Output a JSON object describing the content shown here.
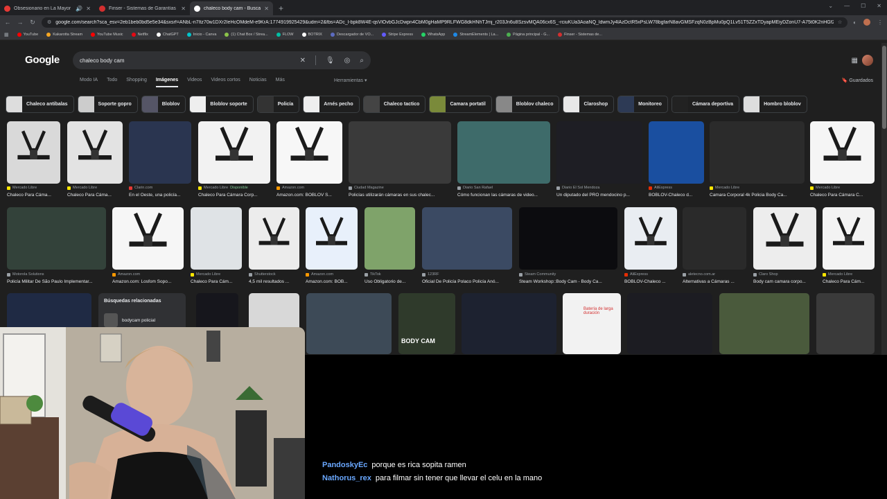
{
  "browser": {
    "tabs": [
      {
        "title": "Obsesionario en La Mayor",
        "color": "#e53935"
      },
      {
        "title": "Finser - Sistemas de Garantías",
        "color": "#d32f2f"
      },
      {
        "title": "chaleco body cam - Buscar con Google",
        "color": "#ffffff"
      }
    ],
    "new_tab": "+",
    "url": "google.com/search?sca_esv=2eb1beb0bd5e5e34&sxsrf=ANbL-n7Itz70w1DXr2IeHcOMdeM-e9KrA:1774919925429&udm=2&fbs=ADc_l-bpk8W4E-qsVlOvbGJcDwpn4CbM0gHaMP9RLFWG8dkHNhTJmj_r203Jn6u8SzsvMQA06cx6S_-rciuKUa3AoaNQ_ldwmJy4lAzDctR5xPsLW78bgfarN8avGMSFzqN0zBpMu0pQ1Lv51T5ZZxTDyapMEiyDZonU7-A75t0K2nHGf2sdoDr..."
  },
  "bookmarks": [
    {
      "label": "YouTube",
      "color": "#ff0000"
    },
    {
      "label": "Kakarotta Stream",
      "color": "#f5a623"
    },
    {
      "label": "YouTube Music",
      "color": "#ff0000"
    },
    {
      "label": "Netflix",
      "color": "#e50914"
    },
    {
      "label": "ChatGPT",
      "color": "#ffffff"
    },
    {
      "label": "Inicio - Canva",
      "color": "#00c4cc"
    },
    {
      "label": "(1) Chat Box / Strea...",
      "color": "#8bc34a"
    },
    {
      "label": "FLOW",
      "color": "#00bfa5"
    },
    {
      "label": "BOTRIX",
      "color": "#ffffff"
    },
    {
      "label": "Descargador de VO...",
      "color": "#5c6bc0"
    },
    {
      "label": "Stripe Express",
      "color": "#635bff"
    },
    {
      "label": "WhatsApp",
      "color": "#25d366"
    },
    {
      "label": "StreamElements | La...",
      "color": "#1e88e5"
    },
    {
      "label": "Página principal - G...",
      "color": "#4caf50"
    },
    {
      "label": "Finser - Sistemas de...",
      "color": "#d32f2f"
    }
  ],
  "google": {
    "logo": "Google",
    "query": "chaleco body cam",
    "tabs": [
      "Modo IA",
      "Todo",
      "Shopping",
      "Imágenes",
      "Videos",
      "Videos cortos",
      "Noticias",
      "Más"
    ],
    "active_tab": "Imágenes",
    "tools": "Herramientas",
    "saved": "Guardados"
  },
  "chips": [
    "Chaleco antibalas",
    "Soporte gopro",
    "Bloblov",
    "Bloblov soporte",
    "Policía",
    "Arnés pecho",
    "Chaleco tactico",
    "Camara portatil",
    "Bloblov chaleco",
    "Claroshop",
    "Monitoreo",
    "Cámara deportiva",
    "Hombro bloblov"
  ],
  "row1": [
    {
      "source": "Mercado Libre",
      "title": "Chaleco Para Cáma...",
      "avail": "",
      "bg": "#d9d9d9"
    },
    {
      "source": "Mercado Libre",
      "title": "Chaleco Para Cáma...",
      "avail": "",
      "bg": "#e3e3e3"
    },
    {
      "source": "Clarin.com",
      "title": "En el Oeste, una policía...",
      "avail": "",
      "bg": "#2a3550"
    },
    {
      "source": "Mercado Libre",
      "title": "Chaleco Para Cámara Corp...",
      "avail": "Disponible",
      "bg": "#f2f2f2"
    },
    {
      "source": "Amazon.com",
      "title": "Amazon.com: BOBLOV S...",
      "avail": "",
      "bg": "#f7f7f7"
    },
    {
      "source": "Ciudad Magazine",
      "title": "Policías utilizarán cámaras en sus chalec...",
      "avail": "",
      "bg": "#3a3a3a"
    },
    {
      "source": "Diario San Rafael",
      "title": "Cómo funcionan las cámaras de video...",
      "avail": "",
      "bg": "#3e6b6a"
    },
    {
      "source": "Diario El Sol Mendoza",
      "title": "Un diputado del PRO mendocino p...",
      "avail": "",
      "bg": "#1e1e24"
    },
    {
      "source": "AliExpress",
      "title": "BOBLOV-Chaleco d...",
      "avail": "",
      "bg": "#1a4fa0"
    },
    {
      "source": "Mercado Libre",
      "title": "Camara Corporal 4k Policia Body Ca...",
      "avail": "",
      "bg": "#2b2b2b"
    },
    {
      "source": "Mercado Libre",
      "title": "Chaleco Para Cámara C...",
      "avail": "",
      "bg": "#f5f5f5"
    }
  ],
  "row2": [
    {
      "source": "Motorola Solutions",
      "title": "Policía Militar De São Paulo Implementar...",
      "bg": "#33423a"
    },
    {
      "source": "Amazon.com",
      "title": "Amazon.com: Losfom Sopo...",
      "bg": "#f6f6f6"
    },
    {
      "source": "Mercado Libre",
      "title": "Chaleco Para Cám...",
      "bg": "#dfe3e6"
    },
    {
      "source": "Shutterstock",
      "title": "4,5 mil resultados ...",
      "bg": "#ececec"
    },
    {
      "source": "Amazon.com",
      "title": "Amazon.com: BOB...",
      "bg": "#e8f0fb"
    },
    {
      "source": "TikTok",
      "title": "Uso Obligatorio de...",
      "bg": "#7fa36a"
    },
    {
      "source": "123RF",
      "title": "Oficial De Policía Polaco Policía Anó...",
      "bg": "#3b4a63"
    },
    {
      "source": "Steam Community",
      "title": "Steam Workshop::Body Cam - Body Ca...",
      "bg": "#0c0c0f"
    },
    {
      "source": "AliExpress",
      "title": "BOBLOV-Chaleco ...",
      "bg": "#e9edf2"
    },
    {
      "source": "aletecno.com.ar",
      "title": "Alternativas a Cámaras ...",
      "bg": "#2a2a2a"
    },
    {
      "source": "Claro Shop",
      "title": "Body cam camara corpo...",
      "bg": "#ededed"
    },
    {
      "source": "Mercado Libre",
      "title": "Chaleco Para Cám...",
      "bg": "#f3f3f3"
    }
  ],
  "row3_bgs": [
    "#1f2a44",
    "#16161c",
    "#d8d8d8",
    "#3d4a57",
    "#2f3a2b",
    "#1d2230",
    "#f2f2f2",
    "#1c1c22",
    "#4a5a3c",
    "#3a3a3a"
  ],
  "row3_text": {
    "bodycam_overlay": "BODY CAM",
    "battery_promo": "Batería de larga duración"
  },
  "related": {
    "heading": "Búsquedas relacionadas",
    "item": "bodycam policial"
  },
  "chat": [
    {
      "user": "PandoskyEc",
      "message": "porque es rica sopita ramen"
    },
    {
      "user": "Nathorus_rex",
      "message": "para filmar sin tener que llevar el celu en la mano"
    }
  ]
}
